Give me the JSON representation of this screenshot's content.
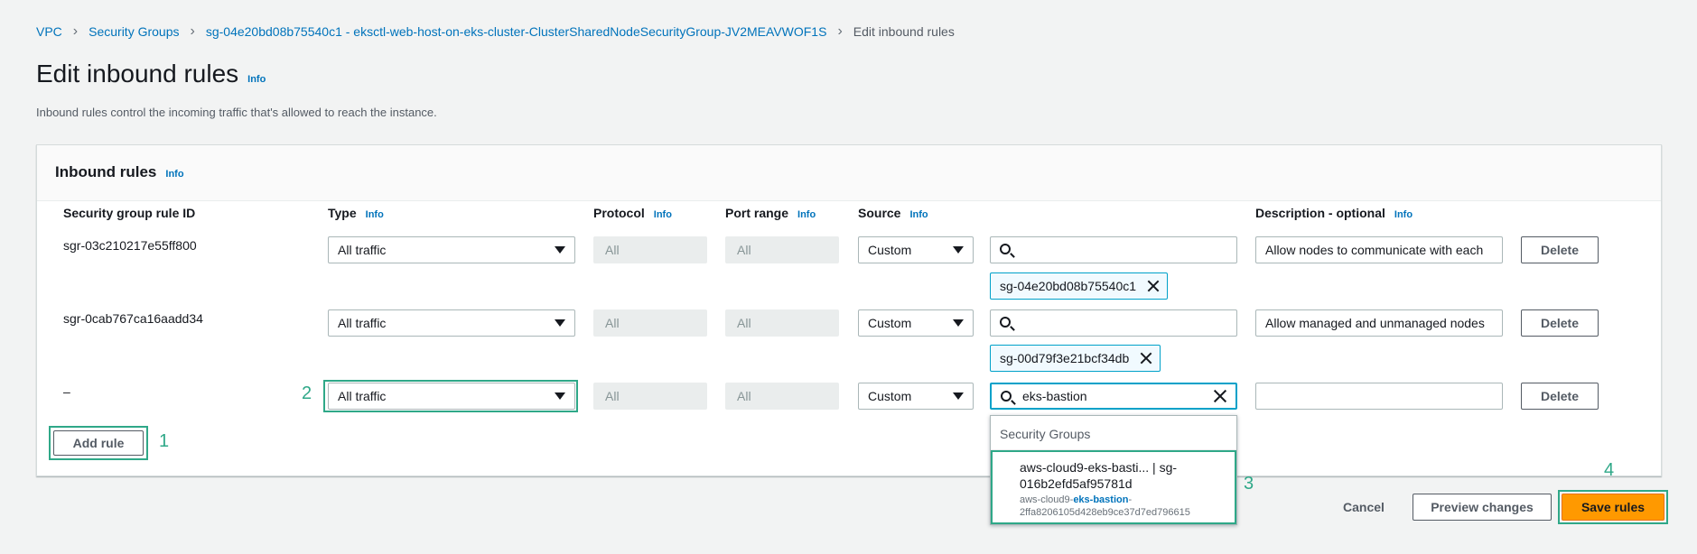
{
  "breadcrumb": {
    "items": [
      "VPC",
      "Security Groups",
      "sg-04e20bd08b75540c1 - eksctl-web-host-on-eks-cluster-ClusterSharedNodeSecurityGroup-JV2MEAVWOF1S"
    ],
    "current": "Edit inbound rules"
  },
  "page": {
    "title": "Edit inbound rules",
    "info": "Info",
    "description": "Inbound rules control the incoming traffic that's allowed to reach the instance."
  },
  "panel": {
    "title": "Inbound rules",
    "info": "Info",
    "columns": {
      "rule_id": "Security group rule ID",
      "type": "Type",
      "protocol": "Protocol",
      "port_range": "Port range",
      "source": "Source",
      "description": "Description - optional",
      "info": "Info"
    }
  },
  "rules": [
    {
      "id": "sgr-03c210217e55ff800",
      "type": "All traffic",
      "protocol": "All",
      "port_range": "All",
      "source": "Custom",
      "search": "",
      "token": "sg-04e20bd08b75540c1",
      "description": "Allow nodes to communicate with each",
      "delete": "Delete"
    },
    {
      "id": "sgr-0cab767ca16aadd34",
      "type": "All traffic",
      "protocol": "All",
      "port_range": "All",
      "source": "Custom",
      "search": "",
      "token": "sg-00d79f3e21bcf34db",
      "description": "Allow managed and unmanaged nodes",
      "delete": "Delete"
    },
    {
      "id": "–",
      "type": "All traffic",
      "protocol": "All",
      "port_range": "All",
      "source": "Custom",
      "search": "eks-bastion",
      "description": "",
      "delete": "Delete"
    }
  ],
  "dropdown": {
    "group": "Security Groups",
    "option_label_line1": "aws-cloud9-eks-basti... | sg-",
    "option_label_line2": "016b2efd5af95781d",
    "option_tag_prefix": "aws-cloud9-",
    "option_tag_match": "eks-bastion",
    "option_tag_suffix": "-",
    "option_tag_line2": "2ffa8206105d428eb9ce37d7ed796615"
  },
  "buttons": {
    "add_rule": "Add rule",
    "cancel": "Cancel",
    "preview": "Preview changes",
    "save": "Save rules"
  },
  "steps": [
    "1",
    "2",
    "3",
    "4"
  ],
  "colors": {
    "accent": "#0073bb",
    "primary": "#ff9900",
    "highlight": "#2fa888",
    "focus": "#00a1c9"
  }
}
